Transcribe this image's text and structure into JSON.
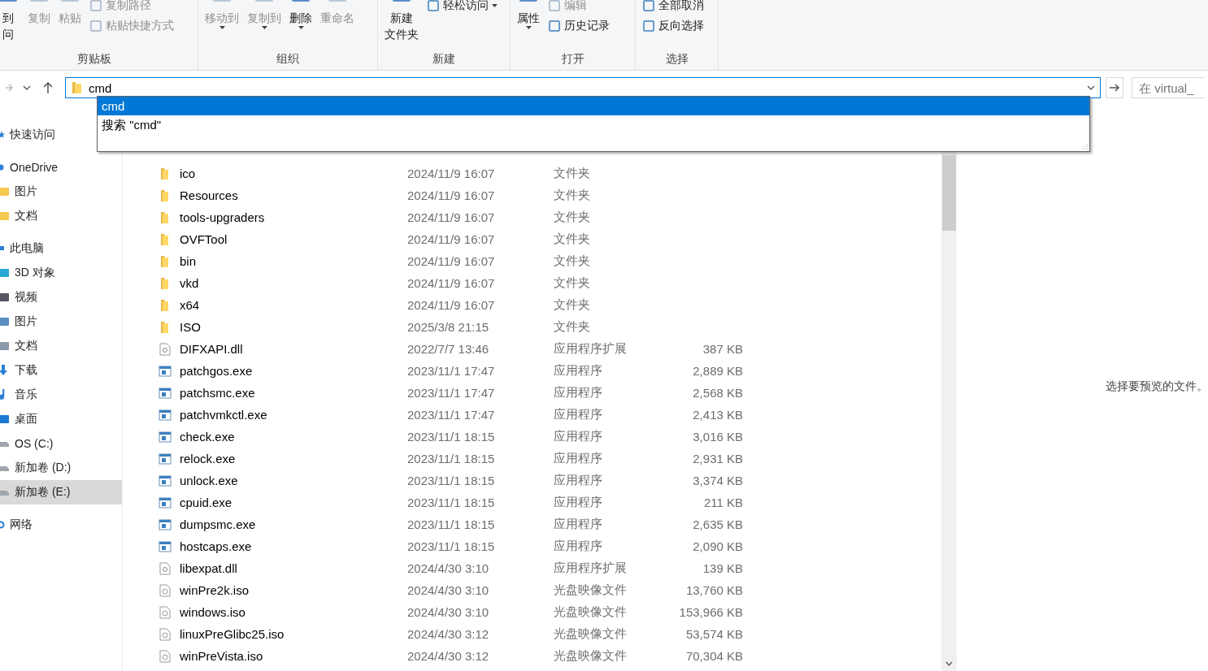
{
  "ribbon": {
    "groups": [
      {
        "name": "剪贴板",
        "items": [
          {
            "kind": "large",
            "lines": [
              "到",
              "问"
            ],
            "disabled": false,
            "caret": false
          },
          {
            "kind": "large",
            "lines": [
              "复制"
            ],
            "disabled": true,
            "caret": false
          },
          {
            "kind": "large",
            "lines": [
              "粘贴"
            ],
            "disabled": true,
            "caret": false
          },
          {
            "kind": "stack",
            "entries": [
              {
                "label": "复制路径",
                "disabled": true,
                "caret": false
              },
              {
                "label": "粘贴快捷方式",
                "disabled": true,
                "caret": false
              }
            ]
          }
        ]
      },
      {
        "name": "组织",
        "items": [
          {
            "kind": "large",
            "lines": [
              "移动到"
            ],
            "disabled": true,
            "caret": true
          },
          {
            "kind": "large",
            "lines": [
              "复制到"
            ],
            "disabled": true,
            "caret": true
          },
          {
            "kind": "large",
            "lines": [
              "删除"
            ],
            "disabled": false,
            "caret": true
          },
          {
            "kind": "large",
            "lines": [
              "重命名"
            ],
            "disabled": true,
            "caret": false
          }
        ]
      },
      {
        "name": "新建",
        "items": [
          {
            "kind": "large",
            "lines": [
              "新建",
              "文件夹"
            ],
            "disabled": false,
            "caret": false
          },
          {
            "kind": "stack",
            "entries": [
              {
                "label": "轻松访问",
                "disabled": false,
                "caret": true
              }
            ]
          }
        ]
      },
      {
        "name": "打开",
        "items": [
          {
            "kind": "large",
            "lines": [
              "属性"
            ],
            "disabled": false,
            "caret": true
          },
          {
            "kind": "stack",
            "entries": [
              {
                "label": "编辑",
                "disabled": true,
                "caret": false
              },
              {
                "label": "历史记录",
                "disabled": false,
                "caret": false
              }
            ]
          }
        ]
      },
      {
        "name": "选择",
        "items": [
          {
            "kind": "stack",
            "entries": [
              {
                "label": "全部取消",
                "disabled": false,
                "caret": false
              },
              {
                "label": "反向选择",
                "disabled": false,
                "caret": false
              }
            ]
          }
        ]
      }
    ]
  },
  "address": {
    "value": "cmd",
    "search_placeholder": "在 virtual_"
  },
  "suggestions": [
    {
      "label": "cmd",
      "selected": true
    },
    {
      "label": "搜索 \"cmd\"",
      "selected": false
    }
  ],
  "sidebar": [
    {
      "label": "快速访问",
      "kind": "star",
      "selected": false
    },
    {
      "label": "OneDrive",
      "kind": "cloud",
      "selected": false,
      "children": [
        {
          "label": "图片",
          "kind": "folder",
          "selected": false
        },
        {
          "label": "文档",
          "kind": "folder",
          "selected": false
        }
      ]
    },
    {
      "label": "此电脑",
      "kind": "pc",
      "selected": false,
      "children": [
        {
          "label": "3D 对象",
          "kind": "cube",
          "selected": false
        },
        {
          "label": "视频",
          "kind": "video",
          "selected": false
        },
        {
          "label": "图片",
          "kind": "image",
          "selected": false
        },
        {
          "label": "文档",
          "kind": "doc",
          "selected": false
        },
        {
          "label": "下载",
          "kind": "download",
          "selected": false
        },
        {
          "label": "音乐",
          "kind": "music",
          "selected": false
        },
        {
          "label": "桌面",
          "kind": "desktop",
          "selected": false
        },
        {
          "label": "OS (C:)",
          "kind": "drive",
          "selected": false
        },
        {
          "label": "新加卷 (D:)",
          "kind": "drive",
          "selected": false
        },
        {
          "label": "新加卷 (E:)",
          "kind": "drive",
          "selected": true
        }
      ]
    },
    {
      "label": "网络",
      "kind": "network",
      "selected": false
    }
  ],
  "files": [
    {
      "name": "ico",
      "date": "2024/11/9 16:07",
      "type": "文件夹",
      "kind": "folder"
    },
    {
      "name": "Resources",
      "date": "2024/11/9 16:07",
      "type": "文件夹",
      "kind": "folder"
    },
    {
      "name": "tools-upgraders",
      "date": "2024/11/9 16:07",
      "type": "文件夹",
      "kind": "folder"
    },
    {
      "name": "OVFTool",
      "date": "2024/11/9 16:07",
      "type": "文件夹",
      "kind": "folder"
    },
    {
      "name": "bin",
      "date": "2024/11/9 16:07",
      "type": "文件夹",
      "kind": "folder"
    },
    {
      "name": "vkd",
      "date": "2024/11/9 16:07",
      "type": "文件夹",
      "kind": "folder"
    },
    {
      "name": "x64",
      "date": "2024/11/9 16:07",
      "type": "文件夹",
      "kind": "folder"
    },
    {
      "name": "ISO",
      "date": "2025/3/8 21:15",
      "type": "文件夹",
      "kind": "folder"
    },
    {
      "name": "DIFXAPI.dll",
      "date": "2022/7/7 13:46",
      "type": "应用程序扩展",
      "size": "387 KB",
      "kind": "dll"
    },
    {
      "name": "patchgos.exe",
      "date": "2023/11/1 17:47",
      "type": "应用程序",
      "size": "2,889 KB",
      "kind": "exe"
    },
    {
      "name": "patchsmc.exe",
      "date": "2023/11/1 17:47",
      "type": "应用程序",
      "size": "2,568 KB",
      "kind": "exe"
    },
    {
      "name": "patchvmkctl.exe",
      "date": "2023/11/1 17:47",
      "type": "应用程序",
      "size": "2,413 KB",
      "kind": "exe"
    },
    {
      "name": "check.exe",
      "date": "2023/11/1 18:15",
      "type": "应用程序",
      "size": "3,016 KB",
      "kind": "exe"
    },
    {
      "name": "relock.exe",
      "date": "2023/11/1 18:15",
      "type": "应用程序",
      "size": "2,931 KB",
      "kind": "exe"
    },
    {
      "name": "unlock.exe",
      "date": "2023/11/1 18:15",
      "type": "应用程序",
      "size": "3,374 KB",
      "kind": "exe"
    },
    {
      "name": "cpuid.exe",
      "date": "2023/11/1 18:15",
      "type": "应用程序",
      "size": "211 KB",
      "kind": "exe"
    },
    {
      "name": "dumpsmc.exe",
      "date": "2023/11/1 18:15",
      "type": "应用程序",
      "size": "2,635 KB",
      "kind": "exe"
    },
    {
      "name": "hostcaps.exe",
      "date": "2023/11/1 18:15",
      "type": "应用程序",
      "size": "2,090 KB",
      "kind": "exe"
    },
    {
      "name": "libexpat.dll",
      "date": "2024/4/30 3:10",
      "type": "应用程序扩展",
      "size": "139 KB",
      "kind": "dll"
    },
    {
      "name": "winPre2k.iso",
      "date": "2024/4/30 3:10",
      "type": "光盘映像文件",
      "size": "13,760 KB",
      "kind": "iso"
    },
    {
      "name": "windows.iso",
      "date": "2024/4/30 3:10",
      "type": "光盘映像文件",
      "size": "153,966 KB",
      "kind": "iso"
    },
    {
      "name": "linuxPreGlibc25.iso",
      "date": "2024/4/30 3:12",
      "type": "光盘映像文件",
      "size": "53,574 KB",
      "kind": "iso"
    },
    {
      "name": "winPreVista.iso",
      "date": "2024/4/30 3:12",
      "type": "光盘映像文件",
      "size": "70,304 KB",
      "kind": "iso"
    }
  ],
  "preview": {
    "message": "选择要预览的文件。"
  }
}
